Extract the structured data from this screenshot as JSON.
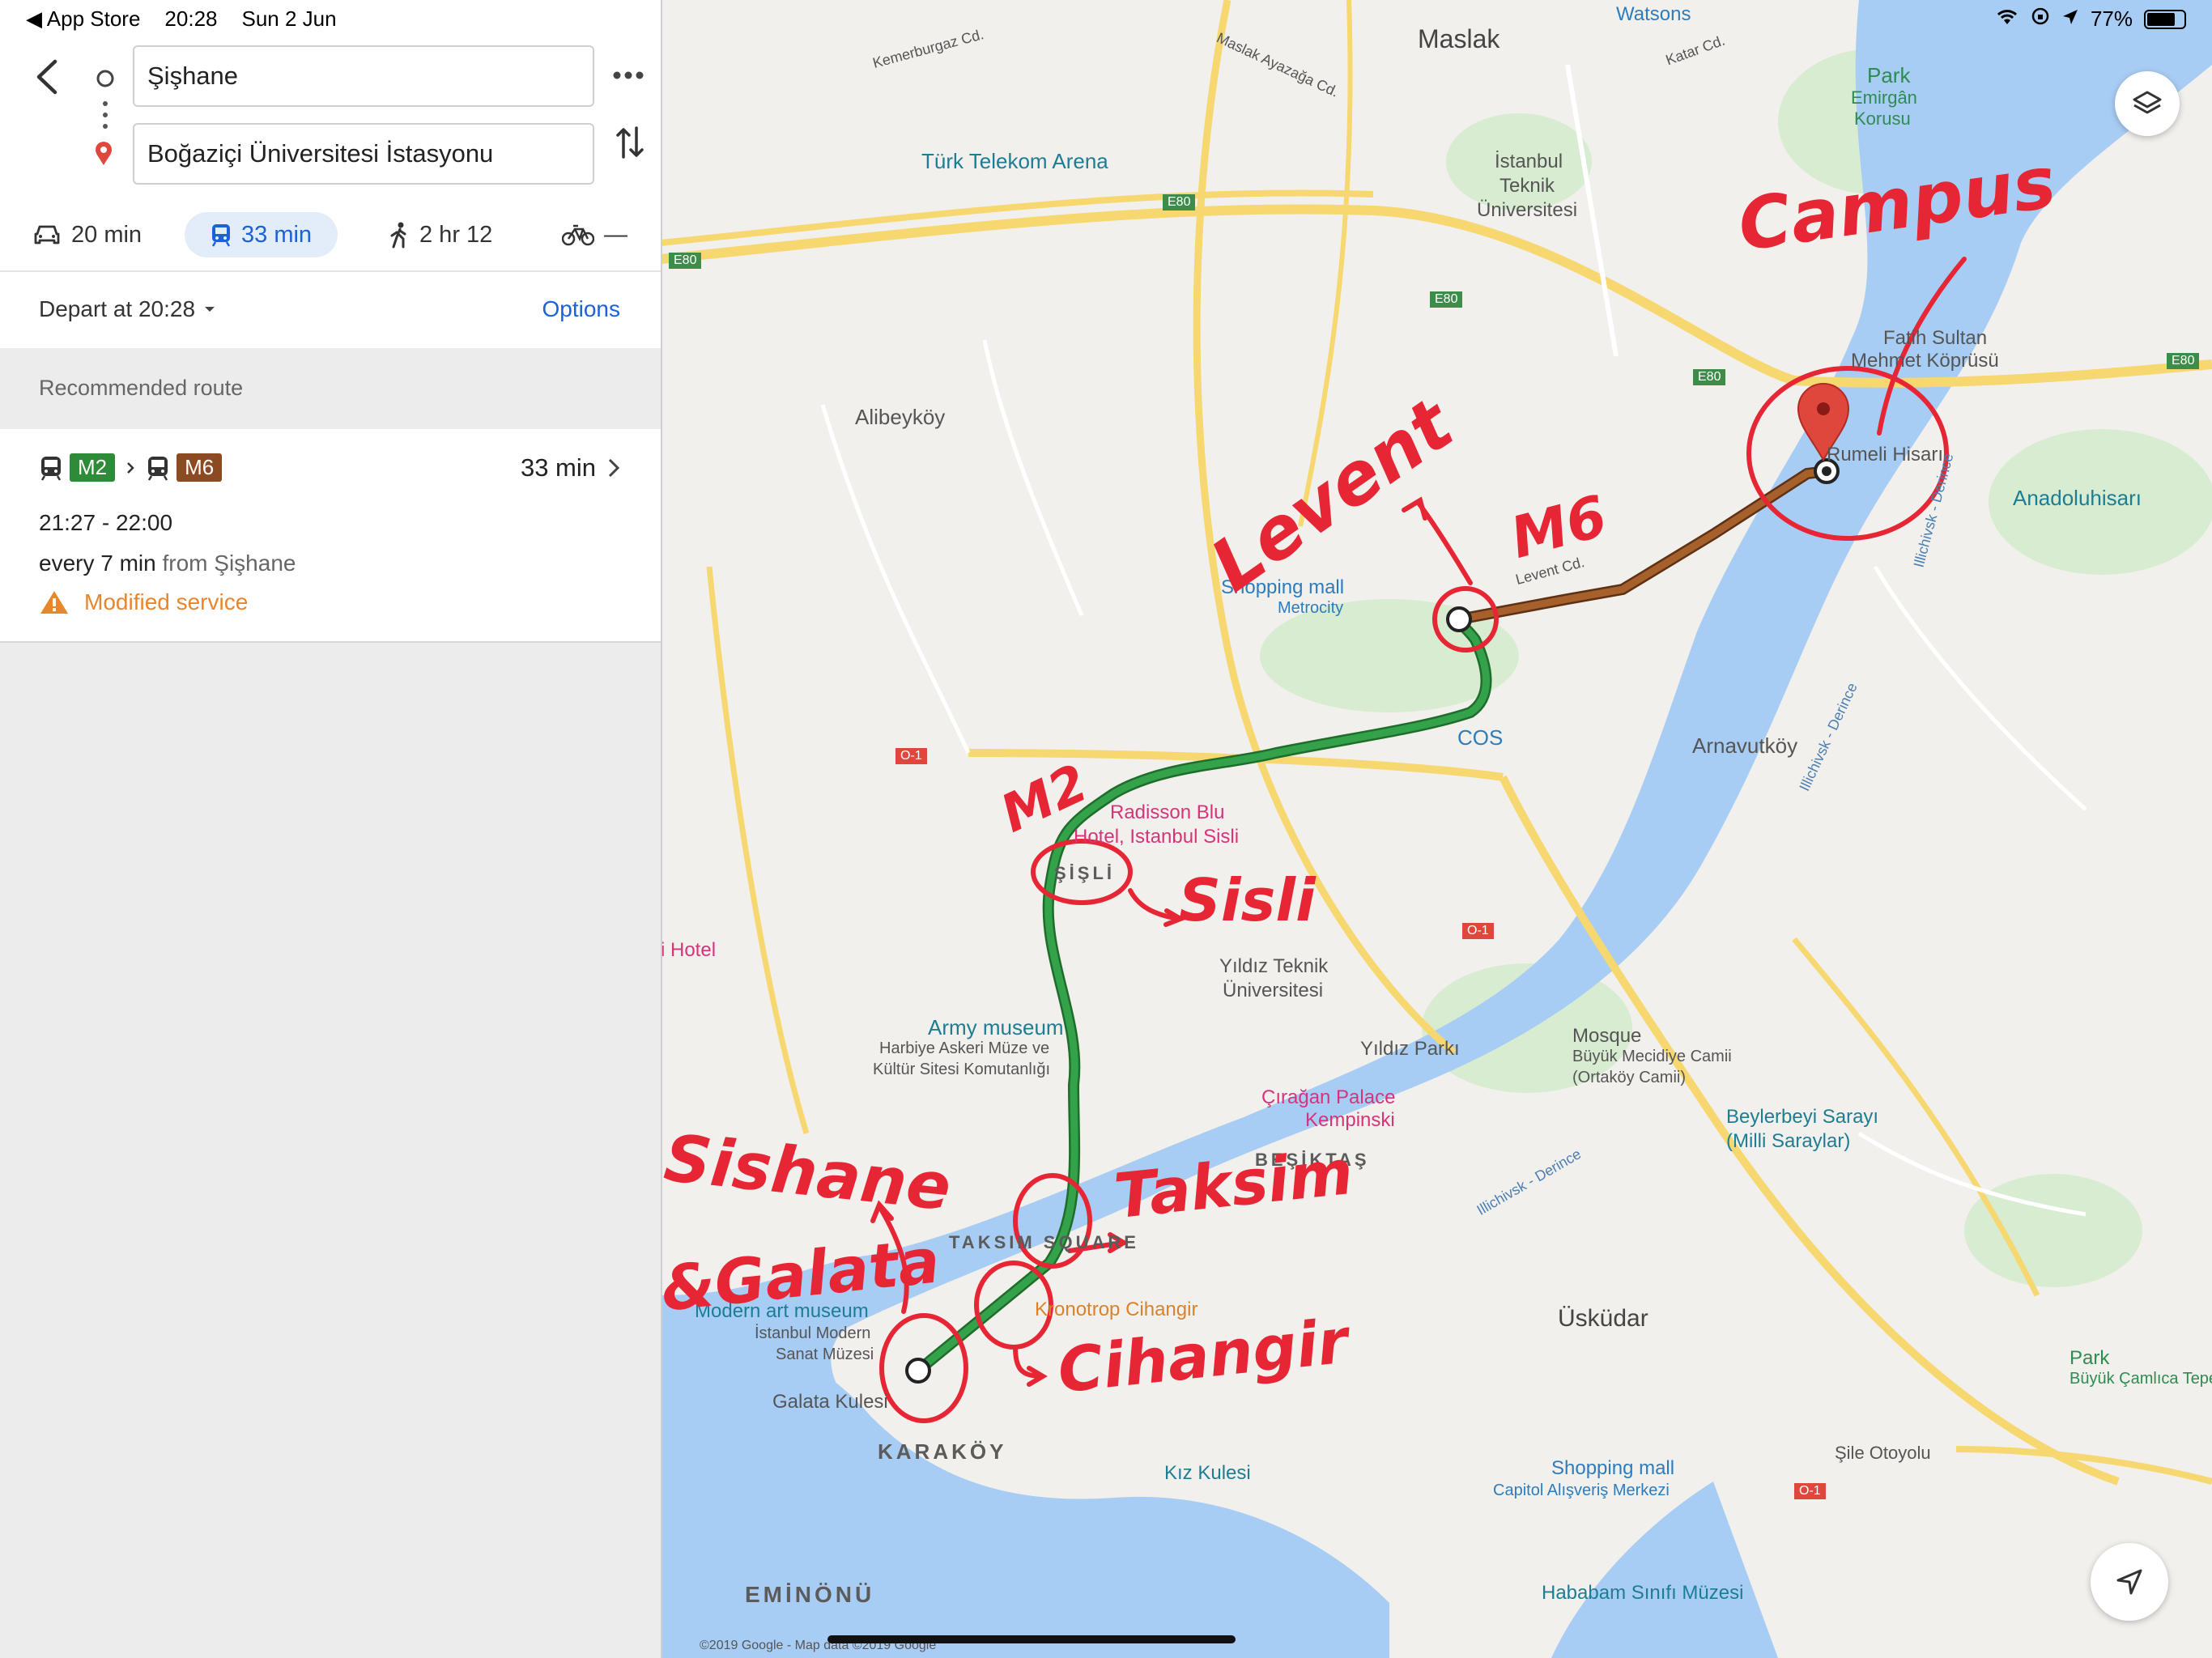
{
  "status": {
    "back_app": "◀ App Store",
    "time": "20:28",
    "date": "Sun 2 Jun",
    "battery": "77%",
    "battery_level": 0.77
  },
  "panel": {
    "origin": "Şişhane",
    "destination": "Boğaziçi Üniversitesi İstasyonu",
    "modes": [
      {
        "icon": "car-icon",
        "label": "20 min"
      },
      {
        "icon": "transit-icon",
        "label": "33 min"
      },
      {
        "icon": "walk-icon",
        "label": "2 hr 12"
      },
      {
        "icon": "bicycle-icon",
        "label": "—"
      }
    ],
    "depart": "Depart at 20:28",
    "options": "Options",
    "recommended": "Recommended route",
    "route": {
      "line1": "M2",
      "line2": "M6",
      "line1_color": "#2e8b37",
      "line2_color": "#8b4a22",
      "duration": "33 min",
      "times": "21:27 - 22:00",
      "frequency": "every 7 min",
      "from_label": "from Şişhane",
      "notice": "Modified service",
      "notice_color": "#e8862b"
    }
  },
  "map": {
    "labels": {
      "maslak": "Maslak",
      "watsons": "Watsons",
      "katar": "Katar Cd.",
      "park_emirgan": "Park",
      "park_emirgan2": "Emirgân",
      "park_emirgan3": "Korusu",
      "kemerburgaz": "Kemerburgaz Cd.",
      "maslak_ayazaga": "Maslak Ayazağa Cd.",
      "turk_telekom": "Türk Telekom Arena",
      "itu1": "İstanbul",
      "itu2": "Teknik",
      "itu3": "Üniversitesi",
      "e80a": "E80",
      "e80b": "E80",
      "e80c": "E80",
      "e80d": "E80",
      "e80e": "E80",
      "fatih1": "Fatih Sultan",
      "fatih2": "Mehmet Köprüsü",
      "alibeykoy": "Alibeyköy",
      "rumeli": "Rumeli Hisarı",
      "anadoluhisari": "Anadoluhisarı",
      "shopping_metrocity1": "Shopping mall",
      "shopping_metrocity2": "Metrocity",
      "levent_cd": "Levent Cd.",
      "cos": "COS",
      "arnavutkoy": "Arnavutköy",
      "radisson1": "Radisson Blu",
      "radisson2": "Hotel, Istanbul Sisli",
      "sisli": "ŞİŞLİ",
      "hotel": "i Hotel",
      "o1a": "O-1",
      "o1b": "O-1",
      "o1c": "O-1",
      "yildiz_teknik1": "Yıldız Teknik",
      "yildiz_teknik2": "Üniversitesi",
      "army1": "Army museum",
      "army2": "Harbiye Askeri Müze ve",
      "army3": "Kültür Sitesi Komutanlığı",
      "yildiz_parki": "Yıldız Parkı",
      "mosque1": "Mosque",
      "mosque2": "Büyük Mecidiye Camii",
      "mosque3": "(Ortaköy Camii)",
      "ciragan1": "Çırağan Palace",
      "ciragan2": "Kempinski",
      "besiktas": "BEŞİKTAŞ",
      "beylerbeyi1": "Beylerbeyi Sarayı",
      "beylerbeyi2": "(Milli Saraylar)",
      "taksim": "TAKSIM SQUARE",
      "modern1": "Modern art museum",
      "modern2": "İstanbul Modern",
      "modern3": "Sanat Müzesi",
      "cihangir_poi": "Kronotrop Cihangir",
      "galata": "Galata Kulesi",
      "karakoy": "KARAKÖY",
      "uskudar": "Üsküdar",
      "park_camlica1": "Park",
      "park_camlica2": "Büyük Çamlıca Tepesi",
      "sile": "Şile Otoyolu",
      "capitol1": "Shopping mall",
      "capitol2": "Capitol Alışveriş Merkezi",
      "kiz_kulesi": "Kız Kulesi",
      "eminonu": "EMİNÖNÜ",
      "hababam": "Hababam Sınıfı Müzesi",
      "copyright": "©2019 Google - Map data ©2019 Google",
      "illichivsk1": "Illichivsk - Derince",
      "illichivsk2": "Illichivsk - Derince",
      "illichivsk3": "Illichivsk - Derince"
    },
    "annotations": {
      "campus": "Campus",
      "levent": "Levent",
      "m6": "M6",
      "m2": "M2",
      "sisli": "Sisli",
      "taksim": "Taksim",
      "cihangir": "Cihangir",
      "sishane": "Sishane",
      "galata": "&Galata"
    },
    "colors": {
      "water": "#a8cdf5",
      "land": "#f2f0ec",
      "green_area": "#d7ecd0",
      "road_major": "#f6d770",
      "road_minor": "#ffffff",
      "ink": "#e62634"
    }
  }
}
